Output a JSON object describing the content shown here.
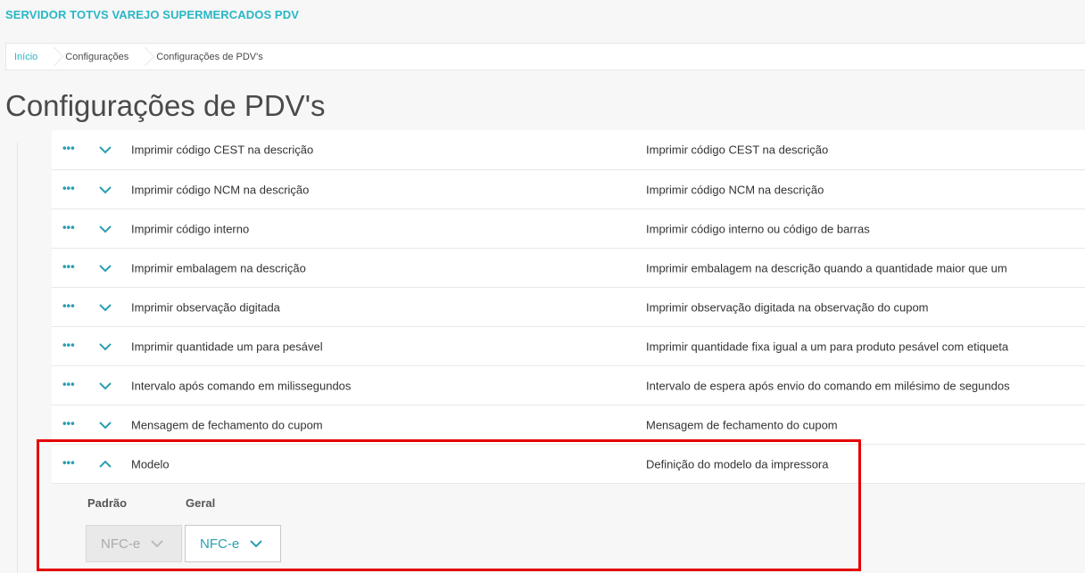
{
  "app": {
    "title": "SERVIDOR TOTVS VAREJO SUPERMERCADOS PDV"
  },
  "breadcrumb": {
    "items": [
      "Início",
      "Configurações",
      "Configurações de PDV's"
    ]
  },
  "page": {
    "title": "Configurações de PDV's"
  },
  "rows": [
    {
      "name": "Imprimir código CEST na descrição",
      "description": "Imprimir código CEST na descrição"
    },
    {
      "name": "Imprimir código NCM na descrição",
      "description": "Imprimir código NCM na descrição"
    },
    {
      "name": "Imprimir código interno",
      "description": "Imprimir código interno ou código de barras"
    },
    {
      "name": "Imprimir embalagem na descrição",
      "description": "Imprimir embalagem na descrição quando a quantidade maior que um"
    },
    {
      "name": "Imprimir observação digitada",
      "description": "Imprimir observação digitada na observação do cupom"
    },
    {
      "name": "Imprimir quantidade um para pesável",
      "description": "Imprimir quantidade fixa igual a um para produto pesável com etiqueta"
    },
    {
      "name": "Intervalo após comando em milissegundos",
      "description": "Intervalo de espera após envio do comando em milésimo de segundos"
    },
    {
      "name": "Mensagem de fechamento do cupom",
      "description": "Mensagem de fechamento do cupom"
    },
    {
      "name": "Modelo",
      "description": "Definição do modelo da impressora"
    }
  ],
  "expanded": {
    "default_label": "Padrão",
    "general_label": "Geral",
    "default_value": "NFC-e",
    "general_value": "NFC-e"
  },
  "more_glyph": "•••",
  "colors": {
    "accent": "#29b6c6",
    "highlight": "#e60000"
  }
}
